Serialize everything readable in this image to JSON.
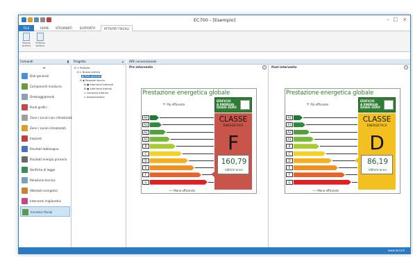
{
  "window": {
    "title": "EC700 - [Esempio]",
    "controls": [
      "–",
      "□",
      "×"
    ]
  },
  "ribbon": {
    "tabs": [
      {
        "label": "FILE"
      },
      {
        "label": "HOME"
      },
      {
        "label": "STRUMENTI"
      },
      {
        "label": "SUPPORTO"
      },
      {
        "label": "ATTIVITA' FISCALI"
      }
    ],
    "buttons": [
      {
        "label": "Nuova pratica"
      },
      {
        "label": "Elimina pratica"
      }
    ]
  },
  "left_panel": {
    "header": "Comandi",
    "items": [
      {
        "label": "Dati generali",
        "color": "#4a90d9"
      },
      {
        "label": "Componenti involucro",
        "color": "#6a9a3a"
      },
      {
        "label": "Ombreggiamenti",
        "color": "#8aa0b8"
      },
      {
        "label": "Ponti grafici",
        "color": "#c44a4a"
      },
      {
        "label": "Zone / Locali non climatizzati",
        "color": "#a0a0a0"
      },
      {
        "label": "Zone / Locali climatizzati",
        "color": "#d8a030"
      },
      {
        "label": "Impianti",
        "color": "#c04040"
      },
      {
        "label": "Risultati fabbisogno",
        "color": "#4a70c0"
      },
      {
        "label": "Risultati energia primaria",
        "color": "#6a6a6a"
      },
      {
        "label": "Verifiche di legge",
        "color": "#3a8a5a"
      },
      {
        "label": "Relazione tecnica",
        "color": "#7aa0c0"
      },
      {
        "label": "Attestati energetici",
        "color": "#d08030"
      },
      {
        "label": "Interventi migliorativi",
        "color": "#c04a8a"
      },
      {
        "label": "Incentivi fiscali",
        "color": "#5a9a4a"
      }
    ]
  },
  "tree_panel": {
    "header": "Progetto",
    "nodes": [
      {
        "label": "Pratiche"
      },
      {
        "label": "Nuova pratica"
      },
      {
        "label": "Dati generali"
      },
      {
        "label": "Requisiti tecnici"
      },
      {
        "label": "Interventi trainanti"
      },
      {
        "label": "Interventi trainati"
      },
      {
        "label": "Computo metrico"
      },
      {
        "label": "Asseverazione"
      }
    ]
  },
  "ape": {
    "header": "APE convenzionale",
    "sections": [
      {
        "title": "Pre intervento",
        "card": {
          "heading": "Prestazione energetica globale",
          "more_efficient": "Più efficiente",
          "less_efficient": "Meno efficiente",
          "nzeb_text": "EDIFICIO\nA ENERGIA\nQUASI ZERO",
          "classe_label": "CLASSE",
          "energetica_label": "ENERGETICA",
          "letter": "F",
          "value": "160,79",
          "unit": "kWh/m²anno",
          "class_color": "#c8544a",
          "active_class": "F"
        }
      },
      {
        "title": "Post intervento",
        "card": {
          "heading": "Prestazione energetica globale",
          "more_efficient": "Più efficiente",
          "less_efficient": "Meno efficiente",
          "nzeb_text": "EDIFICIO\nA ENERGIA\nQUASI ZERO",
          "classe_label": "CLASSE",
          "energetica_label": "ENERGETICA",
          "letter": "D",
          "value": "86,19",
          "unit": "kWh/m²anno",
          "class_color": "#f4c020",
          "active_class": "D"
        }
      }
    ],
    "classes": [
      {
        "label": "A4",
        "color": "#1e7a32",
        "length": 0.14
      },
      {
        "label": "A3",
        "color": "#2e8a3a",
        "length": 0.19
      },
      {
        "label": "A2",
        "color": "#4fa03a",
        "length": 0.25
      },
      {
        "label": "A1",
        "color": "#7ab83a",
        "length": 0.31
      },
      {
        "label": "B",
        "color": "#a8cc30",
        "length": 0.4
      },
      {
        "label": "C",
        "color": "#f4d020",
        "length": 0.5
      },
      {
        "label": "D",
        "color": "#f4b020",
        "length": 0.6
      },
      {
        "label": "E",
        "color": "#f09020",
        "length": 0.7
      },
      {
        "label": "F",
        "color": "#e8602a",
        "length": 0.8
      },
      {
        "label": "G",
        "color": "#e02020",
        "length": 0.9
      }
    ]
  },
  "status": {
    "text": "www.acca.it"
  }
}
